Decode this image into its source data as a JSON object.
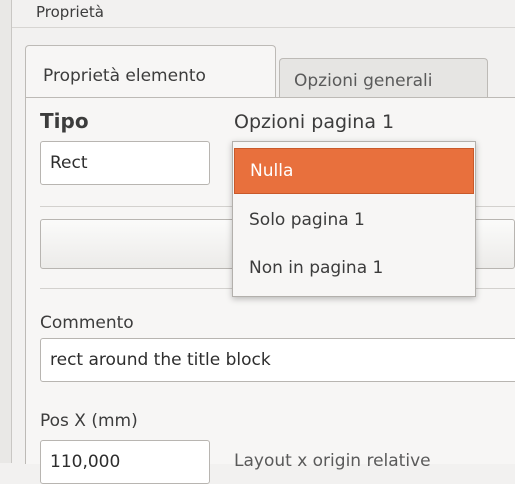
{
  "panel": {
    "title": "Proprietà"
  },
  "tabs": [
    {
      "label": "Proprietà elemento",
      "active": true
    },
    {
      "label": "Opzioni generali",
      "active": false
    }
  ],
  "tipo": {
    "label": "Tipo",
    "value": "Rect"
  },
  "page_options": {
    "label": "Opzioni pagina 1",
    "options": [
      "Nulla",
      "Solo pagina 1",
      "Non in pagina 1"
    ],
    "selected": "Nulla"
  },
  "comment": {
    "label": "Commento",
    "value": "rect around the title block"
  },
  "pos_x": {
    "label": "Pos X (mm)",
    "value": "110,000",
    "hint": "Layout x origin relative"
  },
  "colors": {
    "accent": "#e8703d",
    "background": "#f2f1f0"
  }
}
